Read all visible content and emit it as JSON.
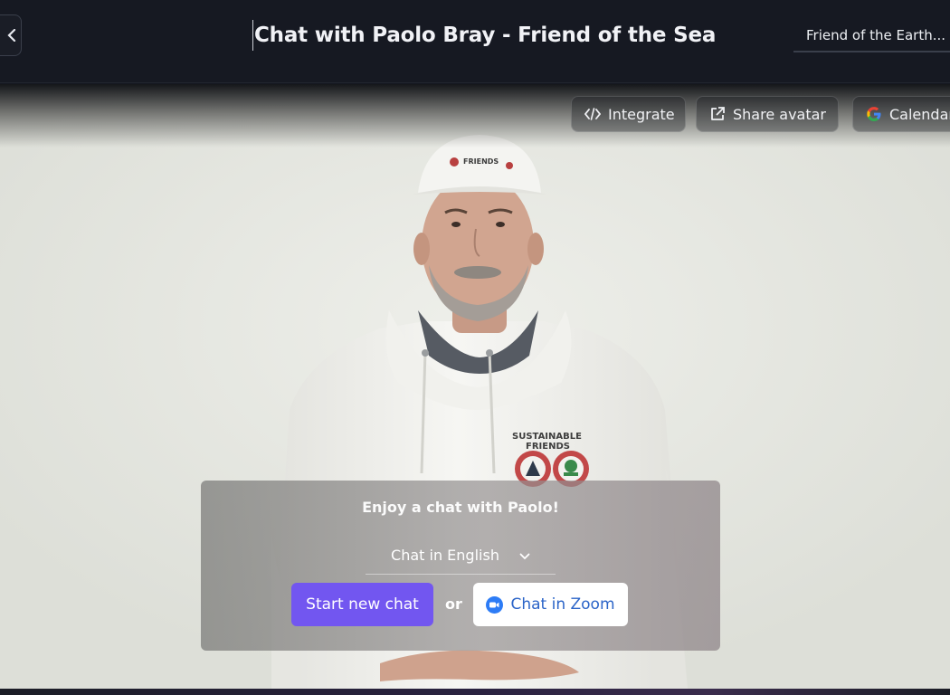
{
  "header": {
    "back_icon": "chevron-left-icon",
    "title": "Chat with Paolo Bray - Friend of the Sea",
    "persona_select_value": "Friend of the Earth..."
  },
  "toolbar": {
    "integrate_label": "Integrate",
    "integrate_icon": "code-icon",
    "share_label": "Share avatar",
    "share_icon": "external-link-icon",
    "calendar_label": "Calendar",
    "calendar_icon": "google-icon"
  },
  "avatar": {
    "cap_text": "FRIENDS",
    "hoodie_text_line1": "SUSTAINABLE",
    "hoodie_text_line2": "FRIENDS"
  },
  "chat_panel": {
    "heading": "Enjoy a chat with Paolo!",
    "language_select_value": "Chat in English",
    "start_button_label": "Start new chat",
    "or_label": "or",
    "zoom_button_label": "Chat in Zoom"
  },
  "colors": {
    "header_bg": "#161922",
    "accent_purple": "#7256f0",
    "zoom_blue": "#2d7cf6",
    "zoom_text": "#2b64c8"
  }
}
